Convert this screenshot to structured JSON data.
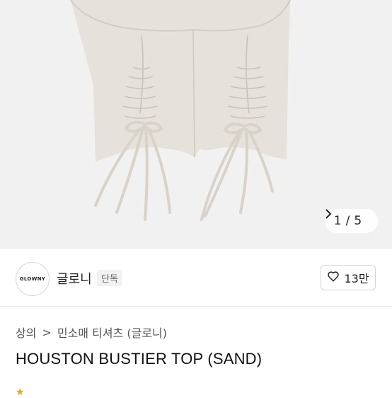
{
  "gallery": {
    "current": "1",
    "separator": "/",
    "total": "5",
    "next_icon": "chevron-right-icon"
  },
  "brand": {
    "logo_text": "GLOWNY",
    "name": "글로니",
    "badge": "단독"
  },
  "like": {
    "count": "13만",
    "icon": "heart-icon"
  },
  "breadcrumb": {
    "level1": "상의",
    "separator": ">",
    "level2": "민소매 티셔츠 (글로니)"
  },
  "product": {
    "title": "HOUSTON BUSTIER TOP (SAND)"
  },
  "colors": {
    "fabric": "#e6e1da",
    "background": "#f1f1f1"
  }
}
